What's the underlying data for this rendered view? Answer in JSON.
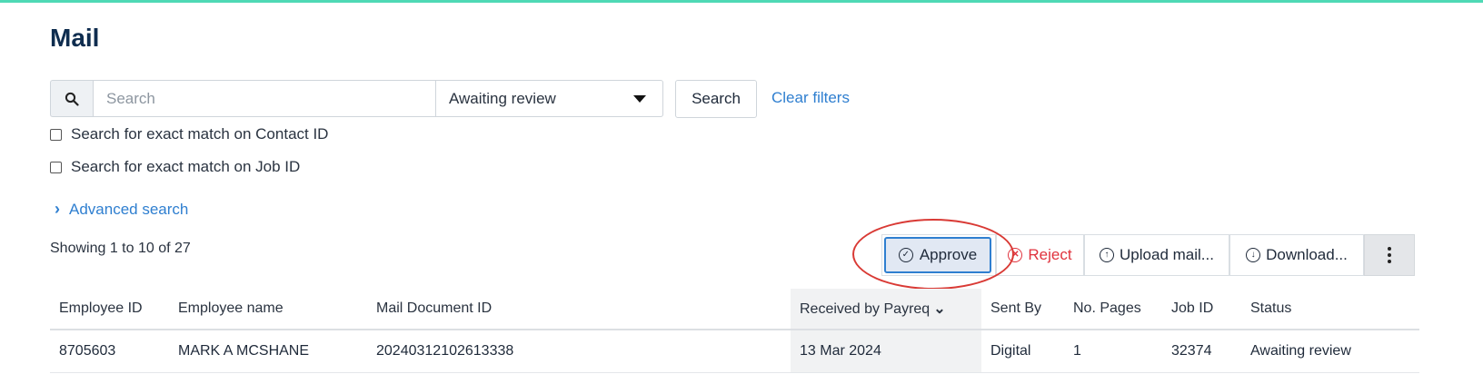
{
  "page": {
    "title": "Mail"
  },
  "search": {
    "placeholder": "Search",
    "value": "",
    "status_filter": "Awaiting review",
    "search_button": "Search",
    "clear_filters": "Clear filters",
    "exact_contact": "Search for exact match on Contact ID",
    "exact_job": "Search for exact match on Job ID",
    "advanced": "Advanced search"
  },
  "results": {
    "showing": "Showing 1 to 10 of 27"
  },
  "toolbar": {
    "approve": "Approve",
    "reject": "Reject",
    "upload": "Upload mail...",
    "download": "Download..."
  },
  "table": {
    "columns": [
      "Employee ID",
      "Employee name",
      "Mail Document ID",
      "Received by Payreq",
      "Sent By",
      "No. Pages",
      "Job ID",
      "Status"
    ],
    "rows": [
      [
        "8705603",
        "MARK A MCSHANE",
        "20240312102613338",
        "13 Mar 2024",
        "Digital",
        "1",
        "32374",
        "Awaiting review"
      ]
    ]
  },
  "colors": {
    "accent": "#2f7fd0",
    "reject": "#e0323d",
    "highlight": "#d93a35",
    "topbar": "#4fd9b5"
  },
  "icons": {
    "search": "magnifier-icon",
    "approve": "check-circle-icon",
    "reject": "x-circle-icon",
    "upload": "arrow-up-circle-icon",
    "download": "arrow-down-circle-icon",
    "more": "vertical-dots-icon",
    "sort": "chevron-down-icon"
  }
}
